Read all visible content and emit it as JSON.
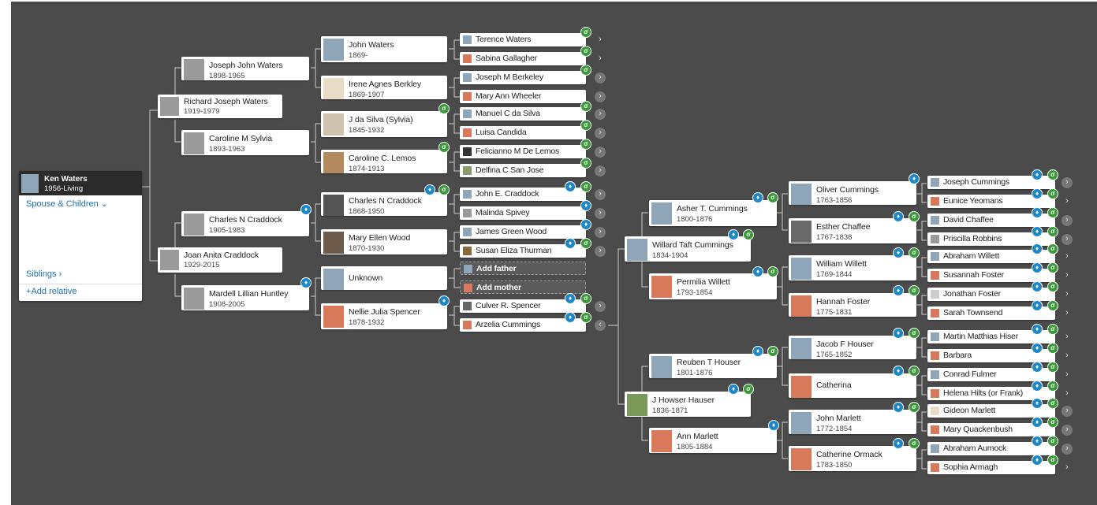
{
  "root": {
    "name": "Ken Waters",
    "dates": "1956-Living",
    "spouse_children": "Spouse & Children",
    "siblings": "Siblings",
    "add_relative": "Add relative"
  },
  "people": {
    "joseph_john_waters": {
      "name": "Joseph John Waters",
      "dates": "1898-1965"
    },
    "richard_joseph_waters": {
      "name": "Richard Joseph Waters",
      "dates": "1919-1979"
    },
    "caroline_m_sylvia": {
      "name": "Caroline M Sylvia",
      "dates": "1893-1963"
    },
    "charles_n_craddock_1": {
      "name": "Charles N Craddock",
      "dates": "1905-1983"
    },
    "joan_anita_craddock": {
      "name": "Joan Anita Craddock",
      "dates": "1929-2015"
    },
    "mardell_lillian_huntley": {
      "name": "Mardell Lillian Huntley",
      "dates": "1908-2005"
    },
    "john_waters": {
      "name": "John Waters",
      "dates": "1869-"
    },
    "irene_agnes_berkley": {
      "name": "Irene Agnes Berkley",
      "dates": "1869-1907"
    },
    "j_da_silva": {
      "name": "J da Silva (Sylvia)",
      "dates": "1845-1932"
    },
    "caroline_c_lemos": {
      "name": "Caroline C. Lemos",
      "dates": "1874-1913"
    },
    "charles_n_craddock_2": {
      "name": "Charles N Craddock",
      "dates": "1868-1950"
    },
    "mary_ellen_wood": {
      "name": "Mary Ellen Wood",
      "dates": "1870-1930"
    },
    "unknown": {
      "name": "Unknown",
      "dates": ""
    },
    "nellie_julia_spencer": {
      "name": "Nellie Julia Spencer",
      "dates": "1878-1932"
    },
    "willard_taft_cummings": {
      "name": "Willard Taft Cummings",
      "dates": "1834-1904"
    },
    "j_howser_hauser": {
      "name": "J Howser Hauser",
      "dates": "1836-1871"
    },
    "asher_t_cummings": {
      "name": "Asher T. Cummings",
      "dates": "1800-1876"
    },
    "permilia_willett": {
      "name": "Permilia Willett",
      "dates": "1793-1854"
    },
    "reuben_t_houser": {
      "name": "Reuben T Houser",
      "dates": "1801-1876"
    },
    "ann_marlett": {
      "name": "Ann Marlett",
      "dates": "1805-1884"
    },
    "oliver_cummings": {
      "name": "Oliver Cummings",
      "dates": "1763-1856"
    },
    "esther_chaffee": {
      "name": "Esther Chaffee",
      "dates": "1767-1838"
    },
    "william_willett": {
      "name": "William Willett",
      "dates": "1769-1844"
    },
    "hannah_foster": {
      "name": "Hannah Foster",
      "dates": "1775-1831"
    },
    "jacob_f_houser": {
      "name": "Jacob F Houser",
      "dates": "1765-1852"
    },
    "catherina": {
      "name": "Catherina",
      "dates": ""
    },
    "john_marlett": {
      "name": "John Marlett",
      "dates": "1772-1854"
    },
    "catherine_ormack": {
      "name": "Catherine Ormack",
      "dates": "1783-1850"
    }
  },
  "small": {
    "terence_waters": "Terence Waters",
    "sabina_gallagher": "Sabina Gallagher",
    "joseph_m_berkeley": "Joseph M Berkeley",
    "mary_ann_wheeler": "Mary Ann Wheeler",
    "manuel_c_da_silva": "Manuel C da Silva",
    "luisa_candida": "Luisa Candida",
    "felicianno_m_de_lemos": "Felicianno M De Lemos",
    "delfina_c_san_jose": "Delfina C San Jose",
    "john_e_craddock": "John E. Craddock",
    "malinda_spivey": "Malinda Spivey",
    "james_green_wood": "James Green Wood",
    "susan_eliza_thurman": "Susan Eliza Thurman",
    "add_father": "Add father",
    "add_mother": "Add mother",
    "culver_r_spencer": "Culver R. Spencer",
    "arzelia_cummings": "Arzelia Cummings",
    "joseph_cummings": "Joseph Cummings",
    "eunice_yeomans": "Eunice Yeomans",
    "david_chaffee": "David Chaffee",
    "priscilla_robbins": "Priscilla Robbins",
    "abraham_willett": "Abraham Willett",
    "susannah_foster": "Susannah Foster",
    "jonathan_foster": "Jonathan Foster",
    "sarah_townsend": "Sarah Townsend",
    "martin_matthias_hiser": "Martin Matthias Hiser",
    "barbara": "Barbara",
    "conrad_fulmer": "Conrad Fulmer",
    "helena_hilts": "Helena Hilts (or Frank)",
    "gideon_marlett": "Gideon Marlett",
    "mary_quackenbush": "Mary Quackenbush",
    "abraham_aumock": "Abraham Aumock",
    "sophia_armagh": "Sophia Armagh"
  },
  "icons": {
    "leaf_hint": "leaf-hint-icon",
    "record_hint": "record-hint-icon",
    "expand": "chevron-right-icon",
    "collapse": "chevron-left-icon"
  },
  "colors": {
    "canvas": "#4b4b4b",
    "leaf_green": "#3a9a3a",
    "record_blue": "#1e88c7",
    "link_blue": "#1b6fae"
  }
}
